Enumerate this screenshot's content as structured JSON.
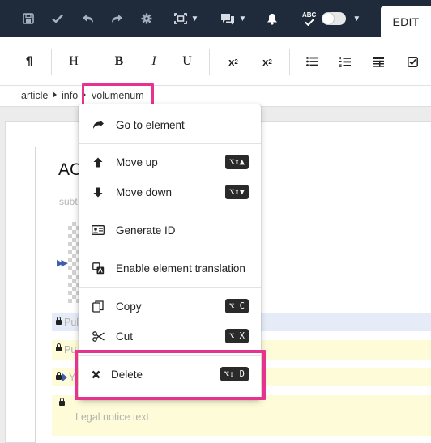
{
  "toolbar": {
    "icons": [
      "save-icon",
      "check-icon",
      "undo-icon",
      "redo-icon",
      "gear-icon",
      "frame-icon",
      "comments-icon",
      "bell-icon",
      "spellcheck-icon"
    ],
    "spellcheck_label": "ABC",
    "edit_tab": "EDIT"
  },
  "format_toolbar": {
    "paragraph": "¶",
    "heading": "H",
    "bold": "B",
    "italic": "I",
    "underline": "U",
    "superscript_base": "x",
    "superscript_mark": "2",
    "subscript_base": "x",
    "subscript_mark": "2"
  },
  "breadcrumb": {
    "items": [
      "article",
      "info",
      "volumenum"
    ]
  },
  "document": {
    "title_prefix": "AC",
    "subtitle_prefix": "subt",
    "row_prefix_1": "Pul",
    "row_prefix_2": "Pu",
    "row_prefix_3": "Y",
    "legal_placeholder": "Legal notice text"
  },
  "context_menu": {
    "go_to_element": "Go to element",
    "move_up": "Move up",
    "move_up_shortcut": "⌥⇧▲",
    "move_down": "Move down",
    "move_down_shortcut": "⌥⇧▼",
    "generate_id": "Generate ID",
    "enable_translation": "Enable element translation",
    "copy": "Copy",
    "copy_shortcut": "⌥ C",
    "cut": "Cut",
    "cut_shortcut": "⌥ X",
    "delete": "Delete",
    "delete_shortcut": "⌥⇧ D"
  },
  "colors": {
    "topbar": "#1f2a3a",
    "highlight": "#e6338f",
    "row_blue": "#e6ecf7",
    "row_yellow": "#fdfbd8"
  }
}
